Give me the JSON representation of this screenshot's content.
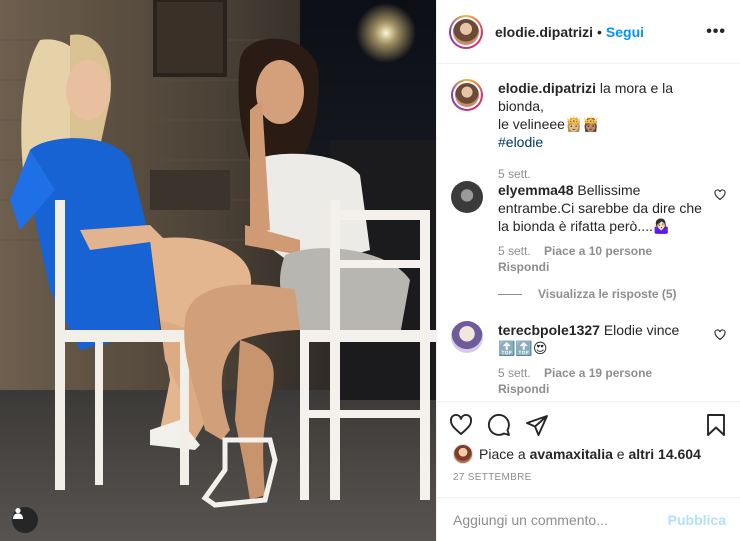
{
  "post": {
    "username": "elodie.dipatrizi",
    "separator": "•",
    "follow_label": "Segui",
    "more_label": "•••",
    "caption_line1": "la mora e la bionda,",
    "caption_line2": "le velineee👸🏼👸🏽",
    "hashtag": "#elodie",
    "caption_time": "5 sett."
  },
  "comments": [
    {
      "username": "elyemma48",
      "text": "Bellissime entrambe.Ci sarebbe da dire che la bionda è rifatta però....🤷🏻‍♀️",
      "time": "5 sett.",
      "likes": "Piace a 10 persone",
      "reply": "Rispondi",
      "view_replies": "Visualizza le risposte (5)"
    },
    {
      "username": "terecbpole1327",
      "text": "Elodie vince",
      "emojis": "🔝🔝😍",
      "time": "5 sett.",
      "likes": "Piace a 19 persone",
      "reply": "Rispondi"
    }
  ],
  "likes": {
    "prefix": "Piace a",
    "user": "avamaxitalia",
    "middle": "e",
    "others": "altri 14.604"
  },
  "date": "27 SETTEMBRE",
  "composer": {
    "placeholder": "Aggiungi un commento...",
    "publish_label": "Pubblica"
  },
  "icons": [
    "heart-icon",
    "comment-icon",
    "share-icon",
    "bookmark-icon",
    "tag-user-icon",
    "more-icon"
  ]
}
